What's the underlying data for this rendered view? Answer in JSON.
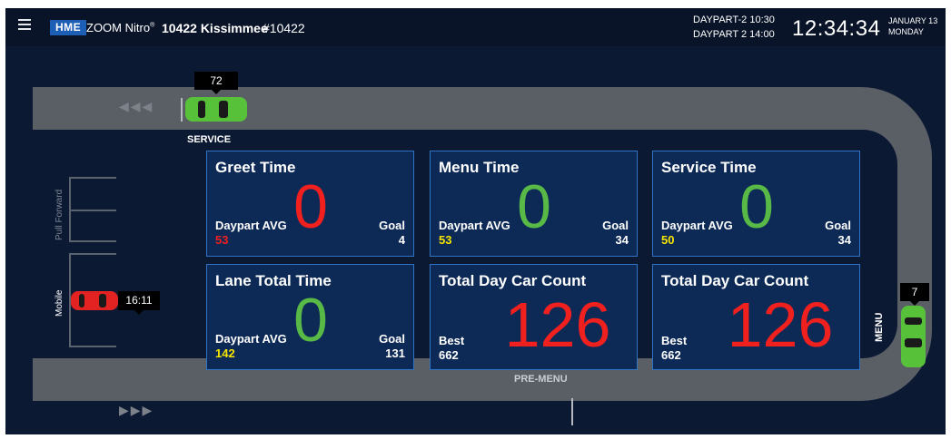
{
  "header": {
    "brand": "HME",
    "product": "ZOOM Nitro",
    "product_mark": "®",
    "store_name": "10422 Kissimmee",
    "store_number": "#10422",
    "daypart_line1": "DAYPART-2  10:30",
    "daypart_line2": "DAYPART 2  14:00",
    "clock": "12:34:34",
    "date_line1": "JANUARY 13",
    "date_line2": "MONDAY"
  },
  "lane": {
    "service_label": "SERVICE",
    "pre_menu_label": "PRE-MENU",
    "menu_label": "MENU",
    "pull_forward_label": "Pull Forward",
    "mobile_label": "Mobile",
    "top_car_time": "72",
    "right_car_time": "7",
    "mobile_car_time": "16:11",
    "arrows_left": "◀◀◀",
    "arrows_right": "▶▶▶",
    "colors": {
      "track": "#5a5f66",
      "car_green": "#58c13a",
      "car_red": "#e32222"
    }
  },
  "cards": [
    {
      "title": "Greet Time",
      "sub_label": "Daypart AVG",
      "sub_value": "53",
      "sub_color": "#f0201f",
      "big_value": "0",
      "big_color": "#f0201f",
      "goal_label": "Goal",
      "goal_value": "4"
    },
    {
      "title": "Menu Time",
      "sub_label": "Daypart AVG",
      "sub_value": "53",
      "sub_color": "#f6e500",
      "big_value": "0",
      "big_color": "#58b947",
      "goal_label": "Goal",
      "goal_value": "34"
    },
    {
      "title": "Service Time",
      "sub_label": "Daypart AVG",
      "sub_value": "50",
      "sub_color": "#f6e500",
      "big_value": "0",
      "big_color": "#58b947",
      "goal_label": "Goal",
      "goal_value": "34"
    },
    {
      "title": "Lane Total Time",
      "sub_label": "Daypart AVG",
      "sub_value": "142",
      "sub_color": "#f6e500",
      "big_value": "0",
      "big_color": "#58b947",
      "goal_label": "Goal",
      "goal_value": "131"
    },
    {
      "title": "Total Day Car Count",
      "best_label": "Best",
      "best_value": "662",
      "big_value": "126",
      "big_color": "#f0201f"
    },
    {
      "title": "Total Day Car Count",
      "best_label": "Best",
      "best_value": "662",
      "big_value": "126",
      "big_color": "#f0201f"
    }
  ]
}
